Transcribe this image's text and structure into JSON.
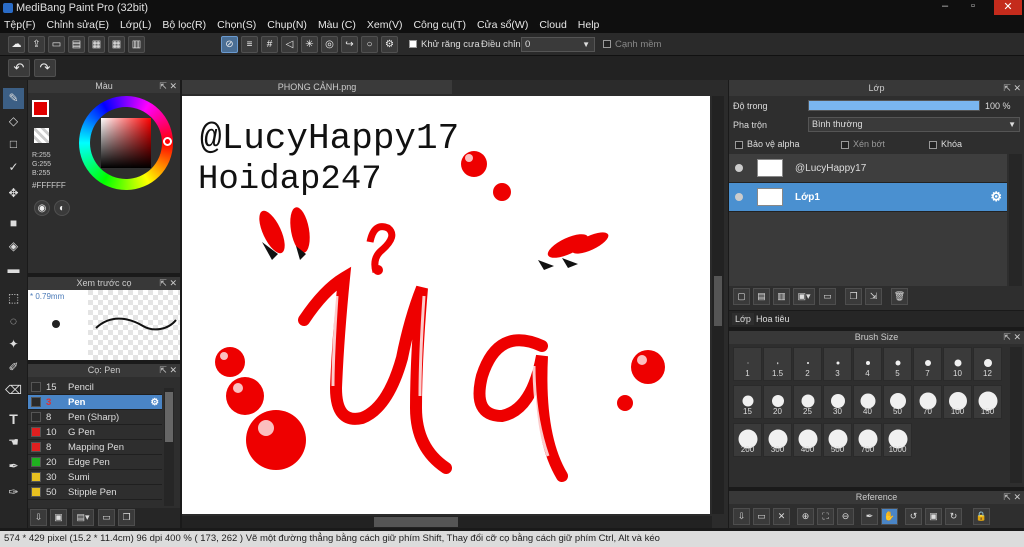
{
  "title": "MediBang Paint Pro (32bit)",
  "window_controls": [
    "–",
    "▫",
    "✕"
  ],
  "menu": [
    "Tệp(F)",
    "Chỉnh sửa(E)",
    "Lớp(L)",
    "Bộ lọc(R)",
    "Chọn(S)",
    "Chụp(N)",
    "Màu (C)",
    "Xem(V)",
    "Công cụ(T)",
    "Cửa sổ(W)",
    "Cloud",
    "Help"
  ],
  "toolbar": {
    "antialias_label": "Khử răng cưa",
    "correction_label": "Điều chỉnh",
    "correction_value": "0",
    "snap_label": "Cạnh mềm"
  },
  "color_panel": {
    "title": "Màu",
    "r": "R:255",
    "g": "G:255",
    "b": "B:255",
    "hex": "#FFFFFF",
    "primary": "#e00000"
  },
  "preview_panel": {
    "title": "Xem trước cọ",
    "size": "* 0.79mm"
  },
  "brush_panel": {
    "title": "Cọ: Pen",
    "items": [
      {
        "size": "15",
        "name": "Pencil",
        "color": "#2a2a2a"
      },
      {
        "size": "3",
        "name": "Pen",
        "color": "#2a2a2a"
      },
      {
        "size": "8",
        "name": "Pen (Sharp)",
        "color": "#2a2a2a"
      },
      {
        "size": "10",
        "name": "G Pen",
        "color": "#e02020"
      },
      {
        "size": "8",
        "name": "Mapping Pen",
        "color": "#e02020"
      },
      {
        "size": "20",
        "name": "Edge Pen",
        "color": "#20b020"
      },
      {
        "size": "30",
        "name": "Sumi",
        "color": "#e8c020"
      },
      {
        "size": "50",
        "name": "Stipple Pen",
        "color": "#e8c020"
      }
    ]
  },
  "document": {
    "tab": "PHONG CẢNH.png",
    "text1": "@LucyHappy17",
    "text2": "Hoidap247"
  },
  "layer_panel": {
    "title": "Lớp",
    "opacity_label": "Độ trong",
    "opacity_value": "100 %",
    "opacity": 1.0,
    "blend_label": "Pha trộn",
    "blend_value": "Bình thường",
    "protect_alpha": "Bảo vệ alpha",
    "clipping": "Xén bớt",
    "lock": "Khóa",
    "layers": [
      "@LucyHappy17",
      "Lớp1"
    ],
    "tabs": [
      "Lớp",
      "Hoa tiêu"
    ]
  },
  "brush_size": {
    "title": "Brush Size",
    "sizes": [
      "1",
      "1.5",
      "2",
      "3",
      "4",
      "5",
      "7",
      "10",
      "12",
      "15",
      "20",
      "25",
      "30",
      "40",
      "50",
      "70",
      "100",
      "150",
      "200",
      "300",
      "400",
      "500",
      "700",
      "1000"
    ]
  },
  "reference": {
    "title": "Reference"
  },
  "status": "574 * 429 pixel   (15.2 * 11.4cm)   96 dpi   400 %   ( 173, 262 )   Vẽ một đường thẳng bằng cách giữ phím Shift, Thay đổi cỡ cọ bằng cách giữ phím Ctrl, Alt và kéo"
}
